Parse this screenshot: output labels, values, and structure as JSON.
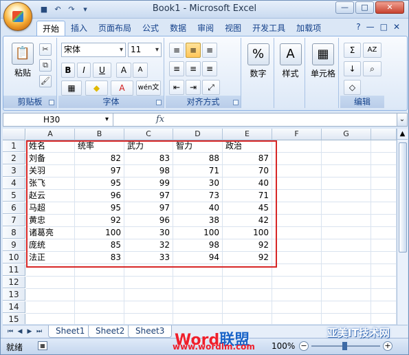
{
  "window": {
    "title": "Book1 - Microsoft Excel",
    "controls": {
      "minimize": "—",
      "restore": "□",
      "close": "✕"
    }
  },
  "quick_access": [
    {
      "name": "save-icon",
      "glyph": "■"
    },
    {
      "name": "undo-icon",
      "glyph": "↶"
    },
    {
      "name": "redo-icon",
      "glyph": "↷"
    },
    {
      "name": "customize-icon",
      "glyph": "▾"
    }
  ],
  "ribbon": {
    "tabs": [
      "开始",
      "插入",
      "页面布局",
      "公式",
      "数据",
      "审阅",
      "视图",
      "开发工具",
      "加载项"
    ],
    "active_tab": "开始",
    "right_icons": [
      "?",
      "—",
      "□",
      "✕"
    ],
    "groups": {
      "clipboard": {
        "label": "剪贴板",
        "paste_label": "粘贴",
        "cut": "✂",
        "copy": "⧉",
        "format_painter": "🖌"
      },
      "font": {
        "label": "字体",
        "font_name": "宋体",
        "font_size": "11",
        "bold": "B",
        "italic": "I",
        "underline": "U",
        "grow": "A",
        "shrink": "A",
        "border": "▦",
        "fill": "◆",
        "font_color": "A",
        "phonetic": "wén文"
      },
      "alignment": {
        "label": "对齐方式",
        "buttons": [
          "≡",
          "≡",
          "≡",
          "≡",
          "≡",
          "≡",
          "⇤",
          "⇥",
          "⤢"
        ]
      },
      "number": {
        "label": "数字",
        "icon": "%"
      },
      "styles": {
        "label": "样式",
        "icon": "A"
      },
      "cells": {
        "label": "单元格",
        "icon": "▦"
      },
      "editing": {
        "label": "编辑",
        "sum": "Σ",
        "sort": "AZ",
        "fill": "↓",
        "find": "⌕",
        "clear": "◇"
      }
    }
  },
  "formula_bar": {
    "name_box": "H30",
    "fx": "fx",
    "value": ""
  },
  "columns": [
    "A",
    "B",
    "C",
    "D",
    "E",
    "F",
    "G"
  ],
  "rows": [
    [
      "姓名",
      "统率",
      "武力",
      "智力",
      "政治",
      "",
      ""
    ],
    [
      "刘备",
      "82",
      "83",
      "88",
      "87",
      "",
      ""
    ],
    [
      "关羽",
      "97",
      "98",
      "71",
      "70",
      "",
      ""
    ],
    [
      "张飞",
      "95",
      "99",
      "30",
      "40",
      "",
      ""
    ],
    [
      "赵云",
      "96",
      "97",
      "73",
      "71",
      "",
      ""
    ],
    [
      "马超",
      "95",
      "97",
      "40",
      "45",
      "",
      ""
    ],
    [
      "黄忠",
      "92",
      "96",
      "38",
      "42",
      "",
      ""
    ],
    [
      "诸葛亮",
      "100",
      "30",
      "100",
      "100",
      "",
      ""
    ],
    [
      "庞统",
      "85",
      "32",
      "98",
      "92",
      "",
      ""
    ],
    [
      "法正",
      "83",
      "33",
      "94",
      "92",
      "",
      ""
    ],
    [
      "",
      "",
      "",
      "",
      "",
      "",
      ""
    ],
    [
      "",
      "",
      "",
      "",
      "",
      "",
      ""
    ],
    [
      "",
      "",
      "",
      "",
      "",
      "",
      ""
    ],
    [
      "",
      "",
      "",
      "",
      "",
      "",
      ""
    ],
    [
      "",
      "",
      "",
      "",
      "",
      "",
      ""
    ]
  ],
  "sheets": [
    "Sheet1",
    "Sheet2",
    "Sheet3"
  ],
  "status": {
    "ready": "就绪",
    "zoom": "100%",
    "zoom_minus": "−",
    "zoom_plus": "+"
  },
  "watermark": {
    "brand_red": "Word",
    "brand_blue": "联盟",
    "url": "www.wordlm.com",
    "corner": "亚美IT技术网"
  },
  "colors": {
    "selection_outline": "#d72626",
    "ribbon_blue": "#15428b",
    "watermark_red": "#ef1f2b",
    "watermark_blue": "#1a64c8"
  }
}
